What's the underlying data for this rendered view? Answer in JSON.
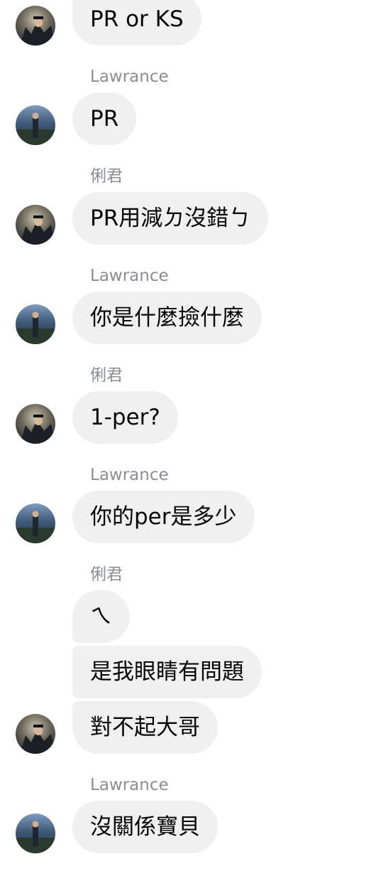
{
  "conversation": {
    "messages": [
      {
        "text": "PR or KS"
      },
      {
        "sender": "Lawrance",
        "text": "PR"
      },
      {
        "sender": "俐君",
        "text": "PR用減ㄉ沒錯ㄅ"
      },
      {
        "sender": "Lawrance",
        "text": "你是什麼撿什麼"
      },
      {
        "sender": "俐君",
        "text": "1-per?"
      },
      {
        "sender": "Lawrance",
        "text": "你的per是多少"
      },
      {
        "sender": "俐君",
        "text": "ㄟ"
      },
      {
        "text": "是我眼睛有問題"
      },
      {
        "text": "對不起大哥"
      },
      {
        "sender": "Lawrance",
        "text": "沒關係寶貝"
      }
    ]
  },
  "avatars": {
    "lijun": {
      "icon": "profile-photo-graduation",
      "bg": "#3a4a5a"
    },
    "lawrance": {
      "icon": "profile-photo-outdoor",
      "bg": "#5b7a95"
    }
  }
}
